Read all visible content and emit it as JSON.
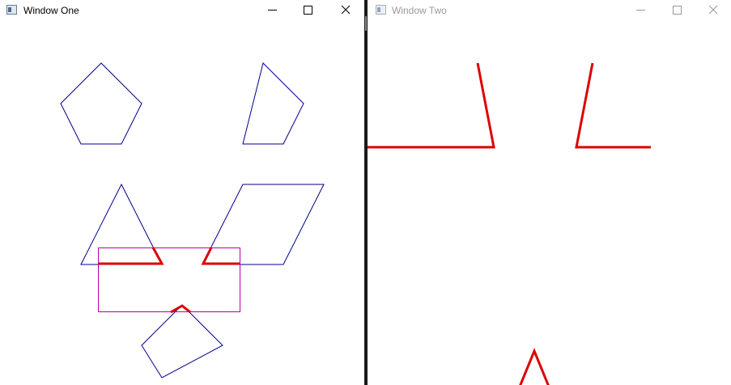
{
  "windows": [
    {
      "title": "Window One",
      "state": "active",
      "controls": [
        "minimize-icon",
        "maximize-icon",
        "close-icon"
      ]
    },
    {
      "title": "Window Two",
      "state": "inactive",
      "controls": [
        "minimize-icon",
        "maximize-icon",
        "close-icon"
      ]
    }
  ],
  "colors": {
    "shape_outline": "#00008b",
    "highlight": "#dd0000",
    "clip_rect": "#b000b0",
    "divider": "#1a1a1a"
  }
}
